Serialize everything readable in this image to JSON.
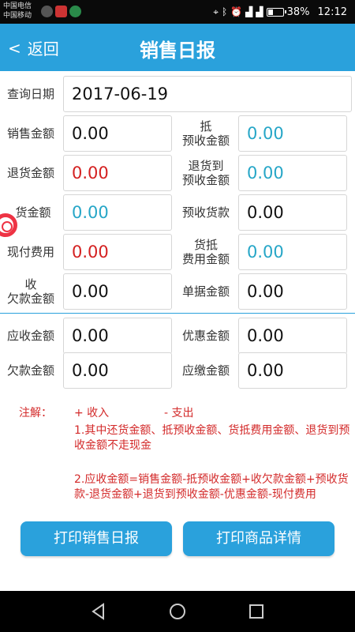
{
  "status": {
    "carrier1": "中国电信",
    "carrier2": "中国移动",
    "battery": "38%",
    "battery_level": 0.38,
    "time": "12:12"
  },
  "header": {
    "back_label": "返回",
    "back_icon": "chevron-left-icon",
    "title": "销售日报"
  },
  "query": {
    "date_label": "查询日期",
    "date_value": "2017-06-19"
  },
  "fields": {
    "sales_amount": {
      "label": "销售金额",
      "value": "0.00"
    },
    "offset_prepaid": {
      "label1": "抵",
      "label2": "预收金额",
      "value": "0.00"
    },
    "return_amount": {
      "label": "退货金额",
      "value": "0.00"
    },
    "return_to_prepaid": {
      "label1": "退货到",
      "label2": "预收金额",
      "value": "0.00"
    },
    "goods_amount": {
      "label": "货金额",
      "value": "0.00"
    },
    "prepaid_payment": {
      "label": "预收货款",
      "value": "0.00"
    },
    "cash_expense": {
      "label": "现付费用",
      "value": "0.00"
    },
    "goods_offset_expense": {
      "label1": "货抵",
      "label2": "费用金额",
      "value": "0.00"
    },
    "collect_debt": {
      "label1": "收",
      "label2": "欠款金额",
      "value": "0.00"
    },
    "document_amount": {
      "label": "单据金额",
      "value": "0.00"
    },
    "receivable": {
      "label": "应收金额",
      "value": "0.00"
    },
    "discount": {
      "label": "优惠金额",
      "value": "0.00"
    },
    "debt": {
      "label": "欠款金额",
      "value": "0.00"
    },
    "payable": {
      "label": "应缴金额",
      "value": "0.00"
    }
  },
  "notes": {
    "title": "注解：",
    "income": "+ 收入",
    "expense": "- 支出",
    "note1": "1.其中还货金额、抵预收金额、货抵费用金额、退货到预收金额不走现金",
    "note2": "2.应收金额=销售金额-抵预收金额+收欠款金额+预收货款-退货金额+退货到预收金额-优惠金额-现付费用"
  },
  "buttons": {
    "print_daily": "打印销售日报",
    "print_goods": "打印商品详情"
  },
  "colors": {
    "primary": "#2aa1dc",
    "negative": "#d42020",
    "offset": "#26a6c7",
    "note": "#d32a2a"
  }
}
